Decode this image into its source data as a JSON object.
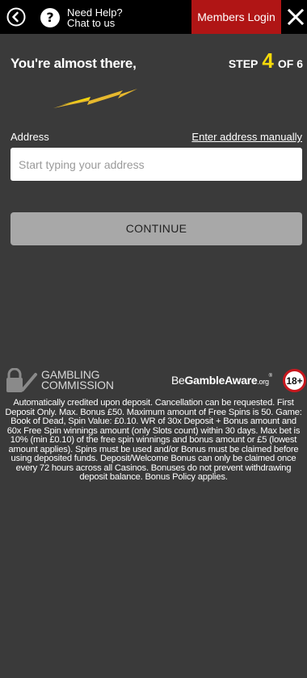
{
  "header": {
    "help_line1": "Need Help?",
    "help_line2": "Chat to us",
    "members_login": "Members Login",
    "icons": {
      "back": "back-arrow-icon",
      "help": "question-icon",
      "close": "close-icon"
    }
  },
  "form": {
    "heading": "You're almost there,",
    "step_prefix": "STEP",
    "step_current": "4",
    "step_suffix": "OF 6",
    "address_label": "Address",
    "address_manual_link": "Enter address manually",
    "address_placeholder": "Start typing your address",
    "continue_label": "CONTINUE"
  },
  "footer": {
    "gambling_commission_line1": "GAMBLING",
    "gambling_commission_line2": "COMMISSION",
    "begambleaware_prefix": "Be",
    "begambleaware_bold": "GambleAware",
    "begambleaware_suffix": ".org",
    "registered": "®",
    "age_badge": "18+",
    "disclaimer": "Automatically credited upon deposit. Cancellation can be requested. First Deposit Only. Max. Bonus £50. Maximum amount of Free Spins is 50. Game: Book of Dead, Spin Value: £0.10. WR of 30x Deposit + Bonus amount and 60x Free Spin winnings amount (only Slots count) within 30 days. Max bet is 10% (min £0.10) of the free spin winnings and bonus amount or £5 (lowest amount applies). Spins must be used and/or Bonus must be claimed before using deposited funds. Deposit/Welcome Bonus can only be claimed once every 72 hours across all Casinos. Bonuses do not prevent withdrawing deposit balance. Bonus Policy applies."
  },
  "colors": {
    "background": "#3a3a3a",
    "topbar": "#000000",
    "members_login": "#b01515",
    "step_accent": "#f5d90a",
    "continue_disabled": "#a8a8a8"
  }
}
